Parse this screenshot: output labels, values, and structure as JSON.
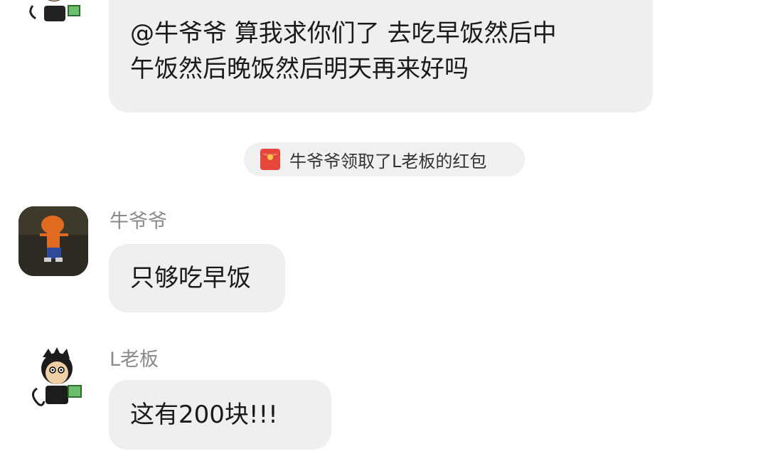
{
  "messages": [
    {
      "lines": [
        "@牛爷爷 算我求你们了 去吃早饭然后中",
        "午饭然后晚饭然后明天再来好吗"
      ]
    },
    {
      "sender": "牛爷爷",
      "text": "只够吃早饭"
    },
    {
      "sender": "L老板",
      "text": "这有200块!!!"
    }
  ],
  "system_notice": {
    "icon": "red-packet-icon",
    "text": "牛爷爷领取了L老板的红包"
  },
  "colors": {
    "bubble": "#efefef",
    "page": "#ffffff",
    "sender_name": "#8a8a8a",
    "red_packet": "#e8453c"
  }
}
